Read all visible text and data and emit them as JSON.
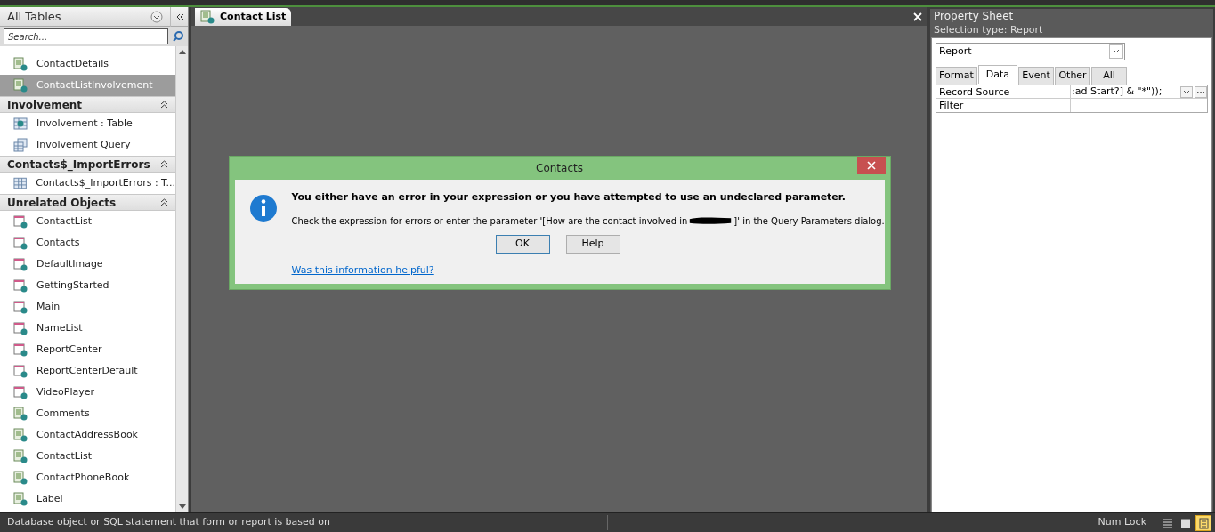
{
  "nav_pane": {
    "title": "All Tables",
    "search": {
      "placeholder": "Search..."
    },
    "groups": [
      {
        "items": [
          {
            "label": "ContactDetails",
            "kind": "report",
            "selected": false
          },
          {
            "label": "ContactListInvolvement",
            "kind": "report",
            "selected": true
          }
        ]
      },
      {
        "title": "Involvement",
        "items": [
          {
            "label": "Involvement : Table",
            "kind": "table-link",
            "selected": false
          },
          {
            "label": "Involvement Query",
            "kind": "query",
            "selected": false
          }
        ]
      },
      {
        "title": "Contacts$_ImportErrors",
        "items": [
          {
            "label": "Contacts$_ImportErrors : T...",
            "kind": "table",
            "selected": false
          }
        ]
      },
      {
        "title": "Unrelated Objects",
        "items": [
          {
            "label": "ContactList",
            "kind": "form",
            "selected": false
          },
          {
            "label": "Contacts",
            "kind": "form",
            "selected": false
          },
          {
            "label": "DefaultImage",
            "kind": "form",
            "selected": false
          },
          {
            "label": "GettingStarted",
            "kind": "form",
            "selected": false
          },
          {
            "label": "Main",
            "kind": "form",
            "selected": false
          },
          {
            "label": "NameList",
            "kind": "form",
            "selected": false
          },
          {
            "label": "ReportCenter",
            "kind": "form",
            "selected": false
          },
          {
            "label": "ReportCenterDefault",
            "kind": "form",
            "selected": false
          },
          {
            "label": "VideoPlayer",
            "kind": "form",
            "selected": false
          },
          {
            "label": "Comments",
            "kind": "report",
            "selected": false
          },
          {
            "label": "ContactAddressBook",
            "kind": "report",
            "selected": false
          },
          {
            "label": "ContactList",
            "kind": "report",
            "selected": false
          },
          {
            "label": "ContactPhoneBook",
            "kind": "report",
            "selected": false
          },
          {
            "label": "Label",
            "kind": "report",
            "selected": false
          }
        ]
      }
    ]
  },
  "document_tab": {
    "label": "Contact List"
  },
  "dialog": {
    "title": "Contacts",
    "heading": "You either have an error in your expression or you have attempted to use an undeclared parameter.",
    "message_before": "Check the expression for errors or enter the parameter '[How are the contact involved in",
    "message_after": "]' in the Query Parameters dialog.",
    "buttons": [
      {
        "label": "OK",
        "selected": true
      },
      {
        "label": "Help",
        "selected": false
      }
    ],
    "link": "Was this information helpful?"
  },
  "property_sheet": {
    "title": "Property Sheet",
    "selection_type": "Selection type:  Report",
    "object": "Report",
    "tabs": [
      {
        "label": "Format",
        "selected": false
      },
      {
        "label": "Data",
        "selected": true
      },
      {
        "label": "Event",
        "selected": false
      },
      {
        "label": "Other",
        "selected": false
      },
      {
        "label": "All",
        "selected": false
      }
    ],
    "rows": [
      {
        "name": "Record Source",
        "value": ":ad Start?] & \"*\"));",
        "builder": true
      },
      {
        "name": "Filter",
        "builder": false
      }
    ]
  },
  "status_bar": {
    "text": "Database object or SQL statement that form or report is based on",
    "indicator": "Num Lock",
    "views": [
      {
        "kind": "datasheet",
        "selected": false
      },
      {
        "kind": "form",
        "selected": false
      },
      {
        "kind": "design",
        "selected": true
      }
    ]
  }
}
